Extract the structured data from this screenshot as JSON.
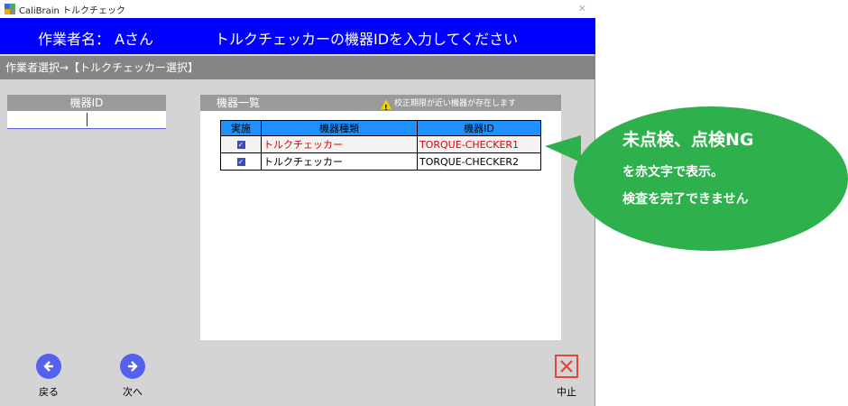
{
  "window": {
    "title": "CaliBrain トルクチェック",
    "close_glyph": "✕"
  },
  "header": {
    "worker_label": "作業者名：",
    "worker_name": "Aさん",
    "instruction": "トルクチェッカーの機器IDを入力してください"
  },
  "breadcrumb": "作業者選択→【トルクチェッカー選択】",
  "device_id_panel": {
    "title": "機器ID",
    "input_value": ""
  },
  "device_list": {
    "title": "機器一覧",
    "warning": "校正期限が近い機器が存在します",
    "columns": [
      "実施",
      "機器種類",
      "機器ID"
    ],
    "rows": [
      {
        "checked": true,
        "type": "トルクチェッカー",
        "id": "TORQUE-CHECKER1",
        "status": "ng"
      },
      {
        "checked": true,
        "type": "トルクチェッカー",
        "id": "TORQUE-CHECKER2",
        "status": "ok"
      }
    ]
  },
  "footer": {
    "back_label": "戻る",
    "next_label": "次へ",
    "stop_label": "中止"
  },
  "callout": {
    "line1": "未点検、点検NG",
    "line2": "を赤文字で表示。",
    "line3": "検査を完了できません"
  },
  "icons": {
    "back": "arrow-left-icon",
    "next": "arrow-right-icon",
    "stop": "x-box-icon",
    "warning": "warning-icon"
  },
  "colors": {
    "header_bg": "#0000ff",
    "table_header_bg": "#1e90ff",
    "ng_text": "#e00000",
    "nav_button": "#5560ec",
    "stop_button": "#e0483a",
    "callout_bg": "#2eb04c"
  }
}
